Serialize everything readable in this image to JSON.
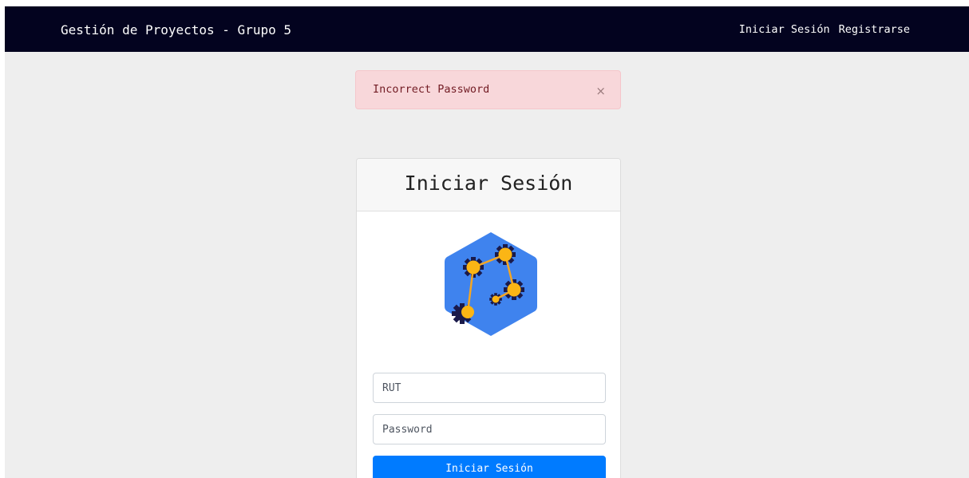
{
  "navbar": {
    "brand": "Gestión de Proyectos - Grupo 5",
    "links": [
      "Iniciar Sesión",
      "Registrarse"
    ],
    "background": "#03031f"
  },
  "alert": {
    "message": "Incorrect Password",
    "close_symbol": "×",
    "background": "#f8d7da"
  },
  "login": {
    "title": "Iniciar Sesión",
    "logo_icon": "hexagon-gears-network-logo",
    "rut_placeholder": "RUT",
    "rut_value": "",
    "password_placeholder": "Password",
    "password_value": "",
    "submit_label": "Iniciar Sesión",
    "accent": "#007bff"
  }
}
